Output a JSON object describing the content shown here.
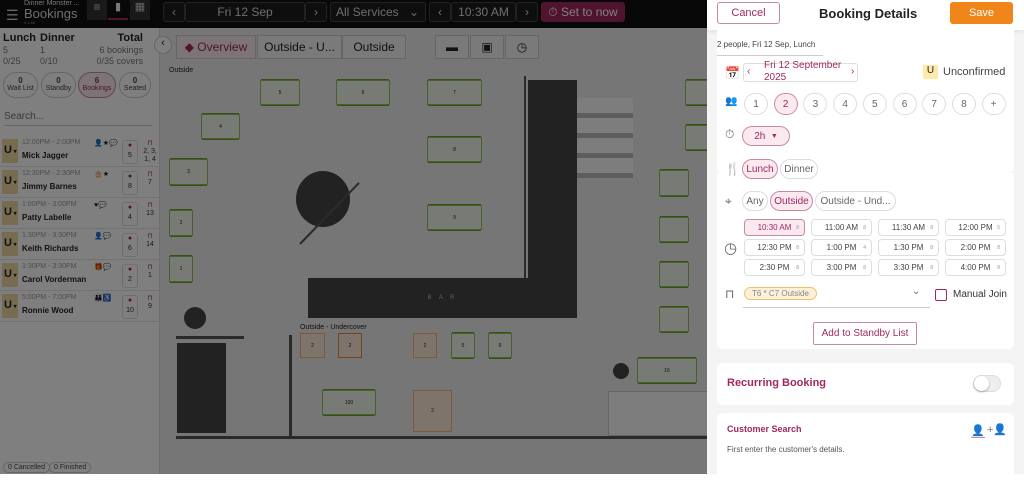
{
  "app": {
    "subtitle": "Dinner Monster ...",
    "title": "Bookings",
    "version": "5.4.88"
  },
  "topbar": {
    "date": "Fri 12 Sep",
    "service": "All Services",
    "time": "10:30 AM",
    "set_now": "Set to now"
  },
  "summary": {
    "lunch_label": "Lunch",
    "lunch_count": "5",
    "lunch_covers": "0/25",
    "dinner_label": "Dinner",
    "dinner_count": "1",
    "dinner_covers": "0/10",
    "total_label": "Total",
    "total_bookings": "6 bookings",
    "total_covers": "0/35 covers"
  },
  "filters": [
    {
      "count": "0",
      "label": "Wait List"
    },
    {
      "count": "0",
      "label": "Standby"
    },
    {
      "count": "6",
      "label": "Bookings"
    },
    {
      "count": "0",
      "label": "Seated"
    }
  ],
  "search_placeholder": "Search...",
  "bookings": [
    {
      "status": "U",
      "time": "12:00PM - 2:00PM",
      "name": "Mick Jagger",
      "icons": "👤★💬",
      "covers": "5",
      "tables": "2, 3, 1, 4"
    },
    {
      "status": "U",
      "time": "12:30PM - 2:30PM",
      "name": "Jimmy Barnes",
      "icons": "🎂★",
      "covers": "8",
      "tables": "7"
    },
    {
      "status": "U",
      "time": "1:00PM - 3:00PM",
      "name": "Patty Labelle",
      "icons": "♥💬",
      "covers": "4",
      "tables": "13"
    },
    {
      "status": "U",
      "time": "1:30PM - 3:30PM",
      "name": "Keith Richards",
      "icons": "👤💬",
      "covers": "6",
      "tables": "14"
    },
    {
      "status": "U",
      "time": "1:30PM - 3:30PM",
      "name": "Carol Vorderman",
      "icons": "🎁💬",
      "covers": "2",
      "tables": "1"
    },
    {
      "status": "U",
      "time": "5:00PM - 7:00PM",
      "name": "Ronnie Wood",
      "icons": "👪♿",
      "covers": "10",
      "tables": "9"
    }
  ],
  "footer": {
    "cancelled": "0 Cancelled",
    "finished": "0 Finished"
  },
  "floor": {
    "tabs": [
      "Overview",
      "Outside - U...",
      "Outside"
    ],
    "area_outside": "Outside",
    "area_undercover": "Outside - Undercover",
    "bar_label": "B A R",
    "tables": {
      "t1": "1",
      "t2": "2",
      "t3": "3",
      "t4": "4",
      "t5": "5",
      "t6": "6",
      "t7": "7",
      "t8": "8",
      "t9": "9",
      "t16": "16",
      "u1": "2",
      "u2": "2",
      "u3": "2",
      "u5": "5",
      "u6": "6",
      "u100": "100",
      "u7": "2"
    }
  },
  "panel": {
    "cancel": "Cancel",
    "title": "Booking Details",
    "save": "Save",
    "summary": "2 people, Fri 12 Sep, Lunch",
    "date": "Fri 12 September 2025",
    "status_badge": "U",
    "status": "Unconfirmed",
    "party_sizes": [
      "1",
      "2",
      "3",
      "4",
      "5",
      "6",
      "7",
      "8",
      "+"
    ],
    "duration": "2h",
    "services": [
      "Lunch",
      "Dinner"
    ],
    "areas": [
      "Any",
      "Outside",
      "Outside - Und..."
    ],
    "slots": [
      {
        "t": "10:30 AM",
        "n": "8"
      },
      {
        "t": "11:00 AM",
        "n": "8"
      },
      {
        "t": "11:30 AM",
        "n": "8"
      },
      {
        "t": "12:00 PM",
        "n": "5"
      },
      {
        "t": "12:30 PM",
        "n": "8"
      },
      {
        "t": "1:00 PM",
        "n": "4"
      },
      {
        "t": "1:30 PM",
        "n": "8"
      },
      {
        "t": "2:00 PM",
        "n": "8"
      },
      {
        "t": "2:30 PM",
        "n": "8"
      },
      {
        "t": "3:00 PM",
        "n": "8"
      },
      {
        "t": "3:30 PM",
        "n": "8"
      },
      {
        "t": "4:00 PM",
        "n": "8"
      }
    ],
    "table_chip": "T6 * C7 Outside",
    "manual_join": "Manual Join",
    "standby": "Add to Standby List",
    "recurring": "Recurring Booking",
    "customer_search": "Customer Search",
    "customer_hint": "First enter the customer's details."
  },
  "colors": {
    "accent": "#a0285f",
    "save": "#f0851a"
  }
}
